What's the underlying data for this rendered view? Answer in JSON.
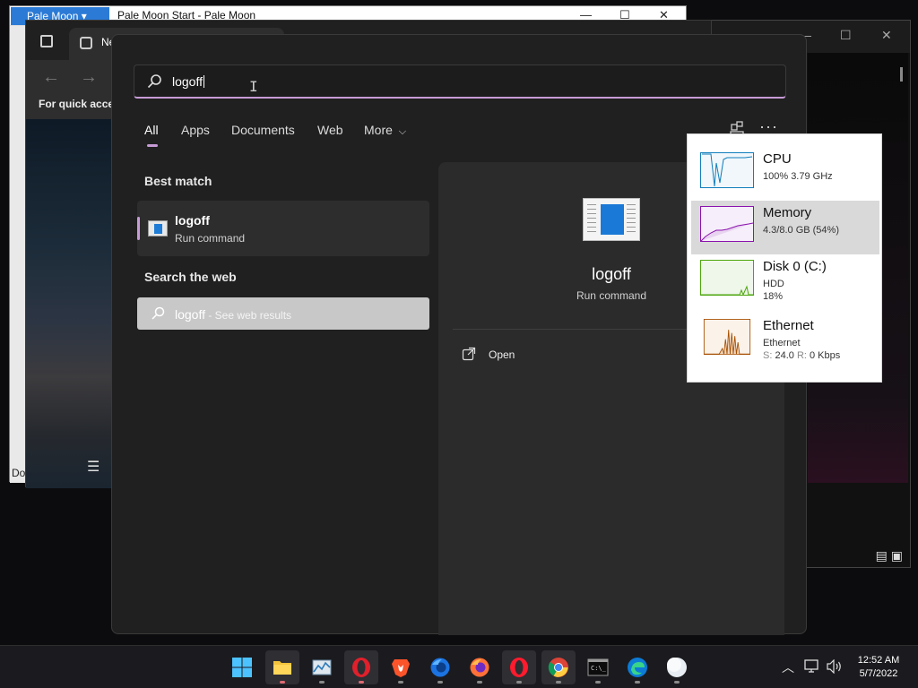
{
  "background": {
    "palemoon": {
      "menu_label": "Pale Moon ▾",
      "title": "Pale Moon Start - Pale Moon",
      "status_text": "Do"
    },
    "edge": {
      "tab_label": "Ne",
      "quick_access_text": "For quick acces"
    }
  },
  "search": {
    "query": "logoff"
  },
  "filters": {
    "tabs": [
      "All",
      "Apps",
      "Documents",
      "Web",
      "More"
    ],
    "more_chevron": "⌵",
    "more_dots": "···"
  },
  "results": {
    "best_match_label": "Best match",
    "best_match": {
      "title": "logoff",
      "subtitle": "Run command"
    },
    "search_web_label": "Search the web",
    "web_result": {
      "query": "logoff",
      "suffix": " - See web results"
    }
  },
  "detail": {
    "title": "logoff",
    "subtitle": "Run command",
    "actions": [
      {
        "label": "Open",
        "icon": "open-icon"
      }
    ]
  },
  "perf_popup": {
    "items": [
      {
        "name": "CPU",
        "line2": "100% 3.79 GHz",
        "line3": "",
        "line3_label_s": "",
        "line3_value_s": "",
        "line3_label_r": "",
        "line3_value_r": "",
        "color": "#117dbb",
        "selected": false
      },
      {
        "name": "Memory",
        "line2": "4.3/8.0 GB (54%)",
        "line3": "",
        "line3_label_s": "",
        "line3_value_s": "",
        "line3_label_r": "",
        "line3_value_r": "",
        "color": "#8b12ae",
        "selected": true
      },
      {
        "name": "Disk 0 (C:)",
        "line2": "HDD",
        "line3": "18%",
        "line3_label_s": "",
        "line3_value_s": "",
        "line3_label_r": "",
        "line3_value_r": "",
        "color": "#4da60c",
        "selected": false
      },
      {
        "name": "Ethernet",
        "line2": "Ethernet",
        "line3": "",
        "line3_label_s": "S:",
        "line3_value_s": " 24.0 ",
        "line3_label_r": "R:",
        "line3_value_r": " 0 Kbps",
        "color": "#a74f01",
        "selected": false
      }
    ]
  },
  "taskbar": {
    "apps": [
      {
        "name": "start-icon",
        "active": false,
        "dot": ""
      },
      {
        "name": "file-explorer-icon",
        "active": true,
        "dot": "red"
      },
      {
        "name": "task-manager-icon",
        "active": false,
        "dot": "gray"
      },
      {
        "name": "opera-icon",
        "active": true,
        "dot": "red"
      },
      {
        "name": "brave-icon",
        "active": false,
        "dot": "gray"
      },
      {
        "name": "firefox-blue-icon",
        "active": false,
        "dot": "gray"
      },
      {
        "name": "firefox-icon",
        "active": false,
        "dot": "gray"
      },
      {
        "name": "opera-gx-icon",
        "active": true,
        "dot": "gray"
      },
      {
        "name": "chrome-icon",
        "active": true,
        "dot": "gray"
      },
      {
        "name": "terminal-icon",
        "active": false,
        "dot": "gray"
      },
      {
        "name": "edge-icon",
        "active": false,
        "dot": "gray"
      },
      {
        "name": "pale-moon-icon",
        "active": false,
        "dot": "gray"
      }
    ],
    "time": "12:52 AM",
    "date": "5/7/2022",
    "tray": [
      "chevron-up-icon",
      "network-icon",
      "volume-icon"
    ]
  }
}
